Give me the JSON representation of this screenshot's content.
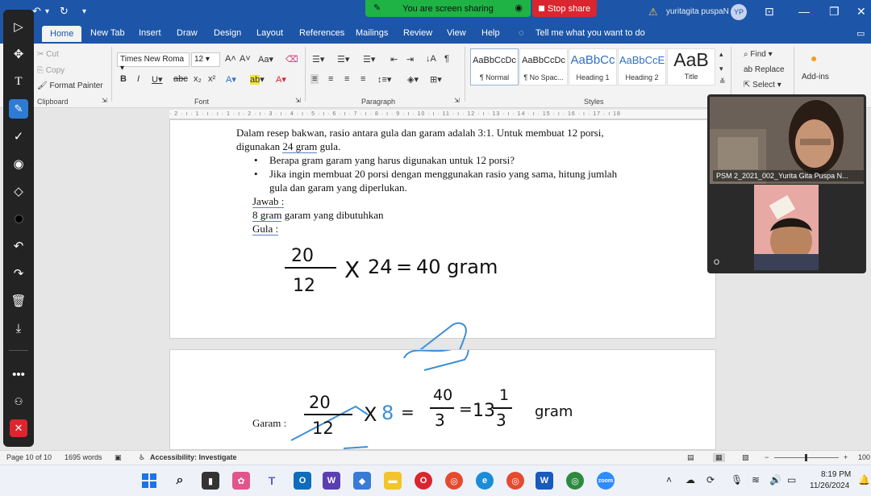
{
  "title_bar": {
    "share_status": "You are screen sharing",
    "stop_share_label": "Stop share",
    "user_name": "yuritagita puspaN",
    "avatar_initials": "YP"
  },
  "ribbon_tabs": [
    "Home",
    "New Tab",
    "Insert",
    "Draw",
    "Design",
    "Layout",
    "References",
    "Mailings",
    "Review",
    "View",
    "Help"
  ],
  "tell_me": "Tell me what you want to do",
  "clipboard": {
    "cut": "Cut",
    "copy": "Copy",
    "format_painter": "Format Painter",
    "group_label": "Clipboard"
  },
  "font": {
    "name": "Times New Roma",
    "size": "12",
    "group_label": "Font"
  },
  "paragraph": {
    "group_label": "Paragraph"
  },
  "styles": {
    "group_label": "Styles",
    "items": [
      {
        "preview": "AaBbCcDc",
        "name": "¶ Normal"
      },
      {
        "preview": "AaBbCcDc",
        "name": "¶ No Spac..."
      },
      {
        "preview": "AaBbCc",
        "name": "Heading 1"
      },
      {
        "preview": "AaBbCcE",
        "name": "Heading 2"
      },
      {
        "preview": "AaB",
        "name": "Title"
      }
    ]
  },
  "editing": {
    "find": "Find",
    "replace": "Replace",
    "select": "Select"
  },
  "addins_label": "Add-ins",
  "ruler_text": "· 2 · ı · 1 · ı · ı · 1 · ı · 2 · ı · 3 · ı · 4 · ı · 5 · ı · 6 · ı · 7 · ı · 8 · ı · 9 · ı · 10 · ı · 11 · ı · 12 · ı · 13 · ı · 14 · ı · 15 · ı · 16 · ı · 17 · ı 18",
  "document": {
    "para_line1": "Dalam resep bakwan, rasio antara gula dan garam adalah 3:1. Untuk membuat 12 porsi,",
    "para_line2_pre": "digunakan ",
    "para_line2_ul": "24 gram",
    "para_line2_post": " gula.",
    "bullet1": "Berapa gram garam yang harus digunakan untuk 12 porsi?",
    "bullet2_line1": "Jika ingin membuat 20 porsi dengan menggunakan rasio yang sama, hitung jumlah",
    "bullet2_line2": "gula dan garam yang diperlukan.",
    "jawab": "Jawab :",
    "answer_ul": "8 gram",
    "answer_rest": " garam yang dibutuhkan",
    "gula_label": "Gula :",
    "garam_label": "Garam :"
  },
  "handwriting": {
    "gula_calc": {
      "num": "20",
      "den": "12",
      "times": "X",
      "mult": "24",
      "eq": "=",
      "result": "40 gram"
    },
    "garam_calc": {
      "num": "20",
      "den": "12",
      "times": "X",
      "mult": "8",
      "eq": "=",
      "frac_num": "40",
      "frac_den": "3",
      "whole": "13",
      "mixed_num": "1",
      "mixed_den": "3",
      "unit": "gram"
    }
  },
  "video": {
    "participant_name": "PSM 2_2021_002_Yurita Gita Puspa N...",
    "badge": "O"
  },
  "status_bar": {
    "page": "Page 10 of 10",
    "words": "1695 words",
    "accessibility": "Accessibility: Investigate",
    "zoom": "100"
  },
  "clock": {
    "time": "8:19 PM",
    "date": "11/26/2024"
  },
  "colors": {
    "word_blue": "#1d56a8",
    "share_green": "#1fb245",
    "stop_red": "#d9262f",
    "ink_blue": "#3c8fd6"
  }
}
